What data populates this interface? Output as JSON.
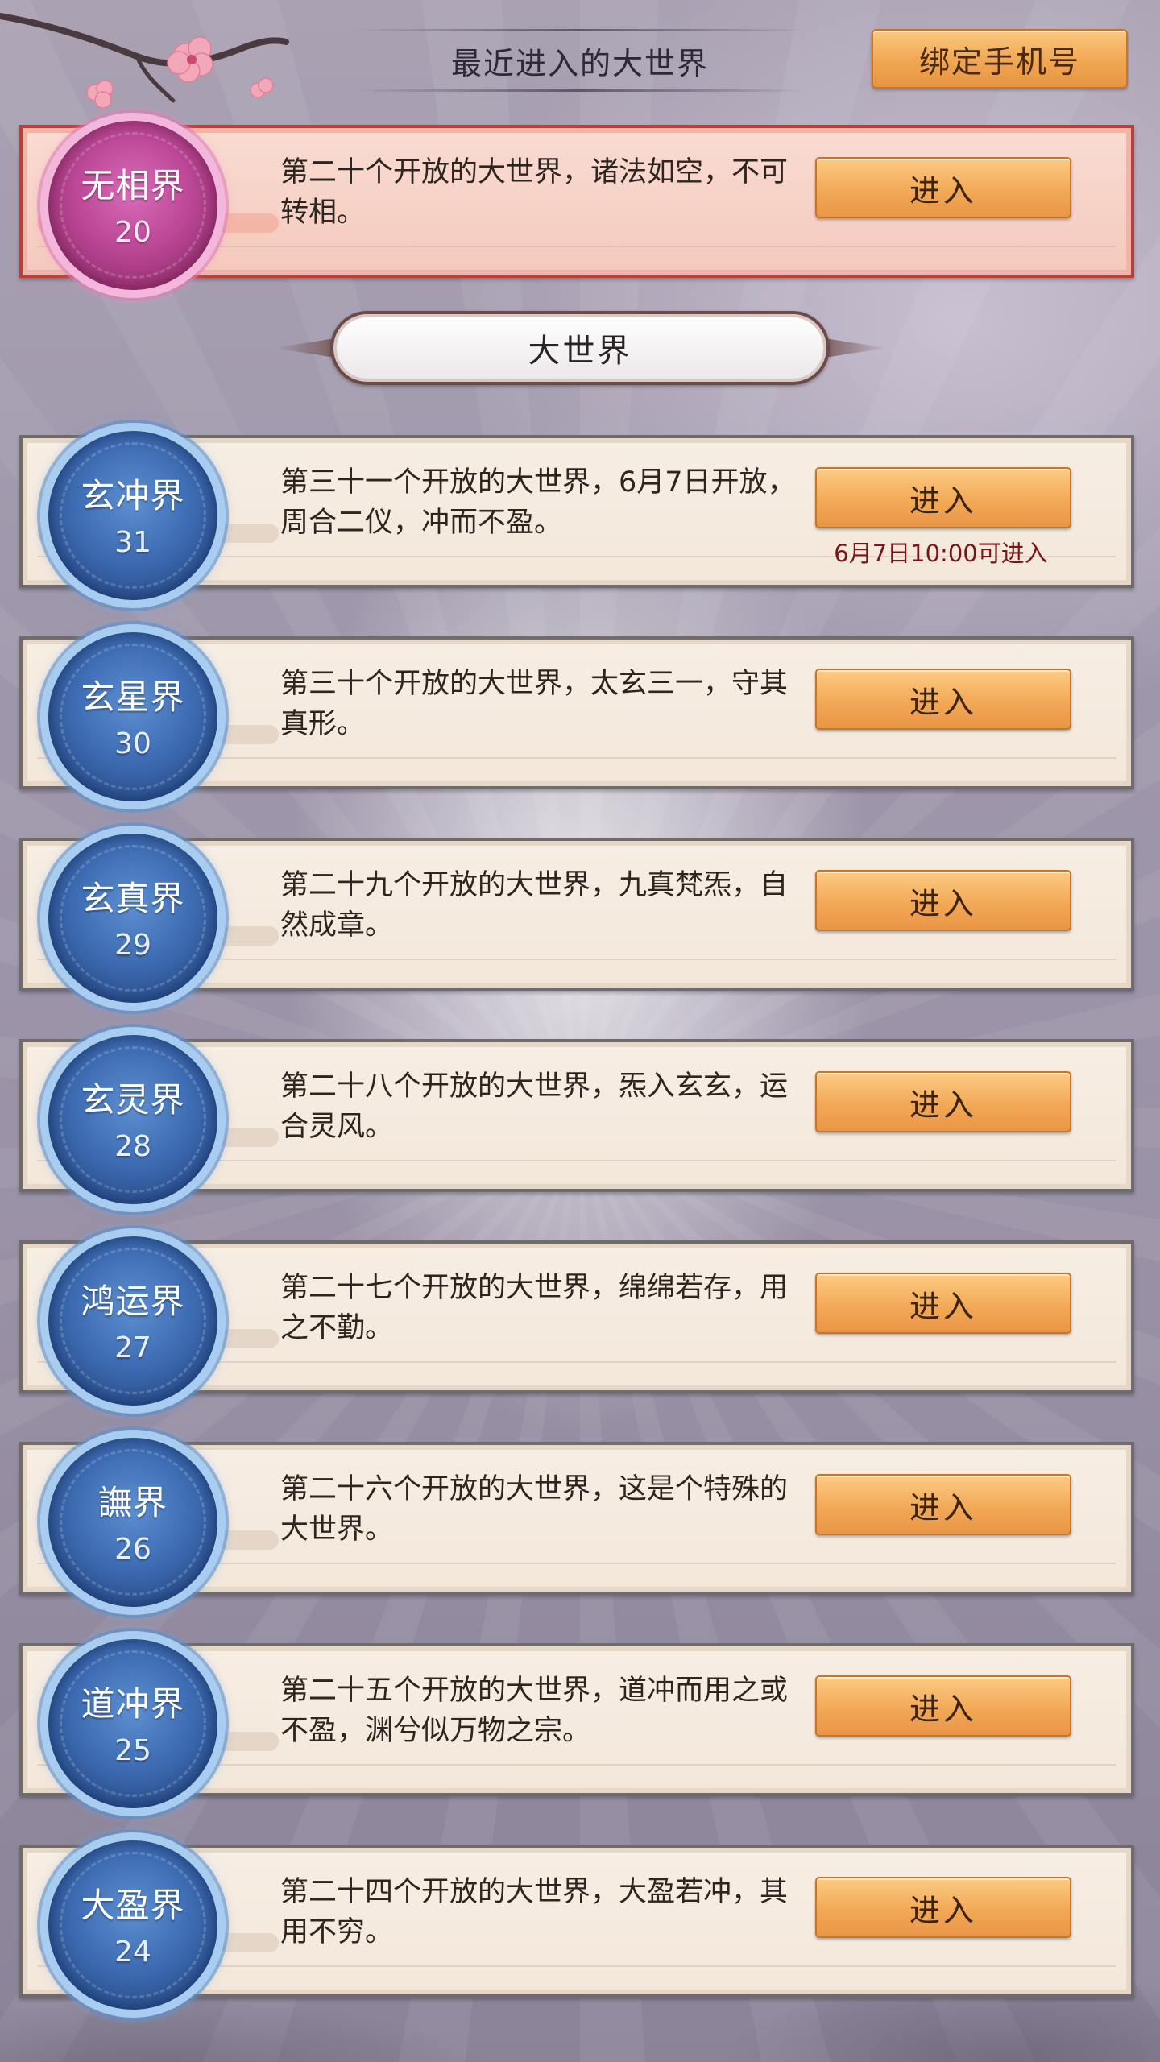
{
  "header": {
    "title": "最近进入的大世界",
    "bind_phone_label": "绑定手机号"
  },
  "recent": {
    "name": "无相界",
    "number": "20",
    "description": "第二十个开放的大世界，诸法如空，不可转相。",
    "enter_label": "进入"
  },
  "section": {
    "title": "大世界"
  },
  "worlds": [
    {
      "name": "玄冲界",
      "number": "31",
      "description": "第三十一个开放的大世界，6月7日开放，周合二仪，冲而不盈。",
      "enter_label": "进入",
      "note": "6月7日10:00可进入"
    },
    {
      "name": "玄星界",
      "number": "30",
      "description": "第三十个开放的大世界，太玄三一，守其真形。",
      "enter_label": "进入"
    },
    {
      "name": "玄真界",
      "number": "29",
      "description": "第二十九个开放的大世界，九真梵炁，自然成章。",
      "enter_label": "进入"
    },
    {
      "name": "玄灵界",
      "number": "28",
      "description": "第二十八个开放的大世界，炁入玄玄，运合灵风。",
      "enter_label": "进入"
    },
    {
      "name": "鸿运界",
      "number": "27",
      "description": "第二十七个开放的大世界，绵绵若存，用之不勤。",
      "enter_label": "进入"
    },
    {
      "name": "譕界",
      "number": "26",
      "description": "第二十六个开放的大世界，这是个特殊的大世界。",
      "enter_label": "进入"
    },
    {
      "name": "道冲界",
      "number": "25",
      "description": "第二十五个开放的大世界，道冲而用之或不盈，渊兮似万物之宗。",
      "enter_label": "进入"
    },
    {
      "name": "大盈界",
      "number": "24",
      "description": "第二十四个开放的大世界，大盈若冲，其用不穷。",
      "enter_label": "进入"
    }
  ],
  "colors": {
    "button": "#f2a957",
    "blue_badge": "#3e6cb3",
    "pink_badge": "#bb4796",
    "note_text": "#7a1515"
  }
}
